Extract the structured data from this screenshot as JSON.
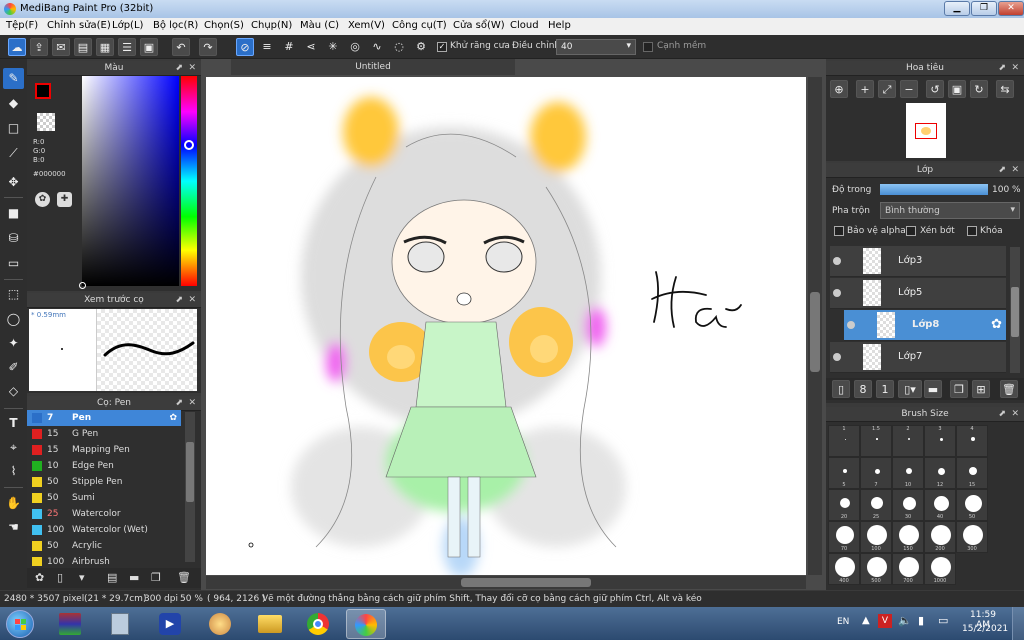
{
  "window": {
    "title": "MediBang Paint Pro (32bit)"
  },
  "menu": [
    "Tệp(F)",
    "Chỉnh sửa(E)",
    "Lớp(L)",
    "Bộ lọc(R)",
    "Chọn(S)",
    "Chụp(N)",
    "Màu (C)",
    "Xem(V)",
    "Công cụ(T)",
    "Cửa sổ(W)",
    "Cloud",
    "Help"
  ],
  "toolbar": {
    "antialias_label": "Khử răng cưa",
    "strength_label": "Điều chỉnh",
    "strength_value": "40",
    "soft_edge_label": "Cạnh mềm"
  },
  "color_panel": {
    "title": "Màu",
    "r": "R:0",
    "g": "G:0",
    "b": "B:0",
    "hex": "#000000"
  },
  "brush_preview": {
    "title": "Xem trước cọ",
    "size": "0.59mm"
  },
  "pen_panel": {
    "title": "Cọ: Pen",
    "items": [
      {
        "size": "7",
        "name": "Pen",
        "color": "#2b6fc8"
      },
      {
        "size": "15",
        "name": "G Pen",
        "color": "#e02020"
      },
      {
        "size": "15",
        "name": "Mapping Pen",
        "color": "#e02020"
      },
      {
        "size": "10",
        "name": "Edge Pen",
        "color": "#20b020"
      },
      {
        "size": "50",
        "name": "Stipple Pen",
        "color": "#f0d020"
      },
      {
        "size": "50",
        "name": "Sumi",
        "color": "#f0d020"
      },
      {
        "size": "25",
        "name": "Watercolor",
        "color": "#40c0f0"
      },
      {
        "size": "100",
        "name": "Watercolor (Wet)",
        "color": "#40c0f0"
      },
      {
        "size": "50",
        "name": "Acrylic",
        "color": "#f0d020"
      },
      {
        "size": "100",
        "name": "Airbrush",
        "color": "#f0d020"
      }
    ]
  },
  "canvas": {
    "tab_title": "Untitled",
    "signature": "Hà"
  },
  "navigator": {
    "title": "Hoa tiêu"
  },
  "layers_panel": {
    "title": "Lớp",
    "opacity_label": "Độ trong",
    "opacity_value": "100 %",
    "opacity_fraction": 1.0,
    "blend_label": "Pha trộn",
    "blend_value": "Bình thường",
    "protect_alpha": "Bảo vệ alpha",
    "clipping": "Xén bớt",
    "lock": "Khóa",
    "layers": [
      {
        "name": "Lớp3",
        "selected": false
      },
      {
        "name": "Lớp5",
        "selected": false
      },
      {
        "name": "Lớp8",
        "selected": true
      },
      {
        "name": "Lớp7",
        "selected": false
      }
    ]
  },
  "brush_size_panel": {
    "title": "Brush Size",
    "sizes": [
      "1",
      "1.5",
      "2",
      "3",
      "4",
      "5",
      "7",
      "10",
      "12",
      "15",
      "20",
      "25",
      "30",
      "40",
      "50",
      "70",
      "100",
      "150",
      "200",
      "300",
      "400",
      "500",
      "700",
      "1000"
    ]
  },
  "status": {
    "dimensions": "2480 * 3507 pixel",
    "paper": "(21 * 29.7cm)",
    "dpi": "300 dpi",
    "zoom": "50 %",
    "coords": "( 964, 2126 )",
    "hint": "Vẽ một đường thẳng bằng cách giữ phím Shift, Thay đổi cỡ cọ bằng cách giữ phím Ctrl, Alt và kéo"
  },
  "taskbar": {
    "lang": "EN",
    "time": "11:59 AM",
    "date": "15/2/2021"
  }
}
